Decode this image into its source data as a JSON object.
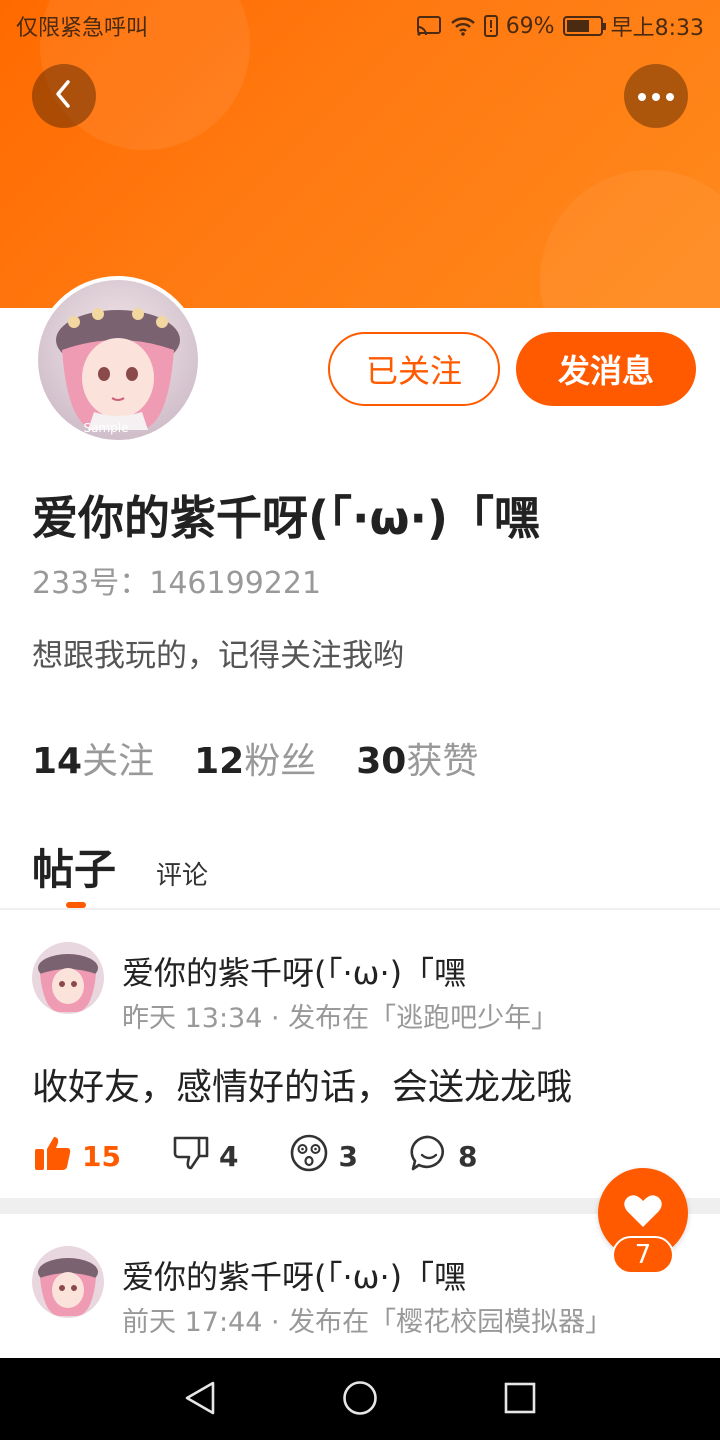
{
  "status_bar": {
    "left_text": "仅限紧急呼叫",
    "battery_text": "69%",
    "battery_level": 0.69,
    "time": "早上8:33"
  },
  "header": {
    "back_icon": "chevron-left-icon",
    "more_icon": "more-horizontal-icon"
  },
  "profile": {
    "avatar_watermark": "Sample",
    "followed_label": "已关注",
    "message_label": "发消息",
    "username": "爱你的紫千呀(「·ω·)「嘿",
    "uid_text": "233号：146199221",
    "bio": "想跟我玩的，记得关注我哟",
    "stats": [
      {
        "num": "14",
        "label": "关注"
      },
      {
        "num": "12",
        "label": "粉丝"
      },
      {
        "num": "30",
        "label": "获赞"
      }
    ]
  },
  "tabs": [
    {
      "label": "帖子",
      "active": true
    },
    {
      "label": "评论",
      "active": false
    }
  ],
  "posts": [
    {
      "author": "爱你的紫千呀(「·ω·)「嘿",
      "meta": "昨天 13:34 · 发布在「逃跑吧少年」",
      "content": "收好友，感情好的话，会送龙龙哦",
      "likes": "15",
      "dislikes": "4",
      "reactions": "3",
      "comments": "8"
    },
    {
      "author": "爱你的紫千呀(「·ω·)「嘿",
      "meta": "前天 17:44 · 发布在「樱花校园模拟器」"
    }
  ],
  "fab": {
    "icon": "heart-icon",
    "count": "7"
  },
  "colors": {
    "accent": "#ff5a00",
    "banner": "#ff7a12"
  }
}
